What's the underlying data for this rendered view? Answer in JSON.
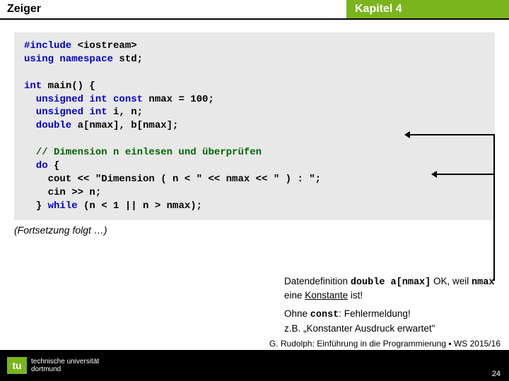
{
  "header": {
    "left": "Zeiger",
    "right": "Kapitel 4"
  },
  "code": {
    "l1a": "#include",
    "l1b": " <iostream>",
    "l2a": "using namespace",
    "l2b": " std;",
    "l3a": "int",
    "l3b": " main() {",
    "l4a": "  unsigned int const",
    "l4b": " nmax = 100;",
    "l5a": "  unsigned int",
    "l5b": " i, n;",
    "l6a": "  double",
    "l6b": " a[nmax], b[nmax];",
    "l7": "  // Dimension n einlesen und überprüfen",
    "l8a": "  do",
    "l8b": " {",
    "l9": "    cout << \"Dimension ( n < \" << nmax << \" ) : \";",
    "l10": "    cin >> n;",
    "l11a": "  } ",
    "l11b": "while",
    "l11c": " (n < 1 || n > nmax);"
  },
  "cont": "(Fortsetzung folgt …)",
  "note1a": "Datendefinition ",
  "note1b": "double a[nmax]",
  "note1c": " OK, weil ",
  "note1d": "nmax",
  "note1e": " eine ",
  "note1f": "Konstante",
  "note1g": " ist!",
  "note2a": "Ohne ",
  "note2b": "const",
  "note2c": ": Fehlermeldung!",
  "note2d": "z.B. „Konstanter Ausdruck erwartet\"",
  "footer": {
    "logoMark": "tu",
    "uni1": "technische universität",
    "uni2": "dortmund",
    "credit": "G. Rudolph: Einführung in die Programmierung ▪ WS 2015/16",
    "page": "24"
  }
}
